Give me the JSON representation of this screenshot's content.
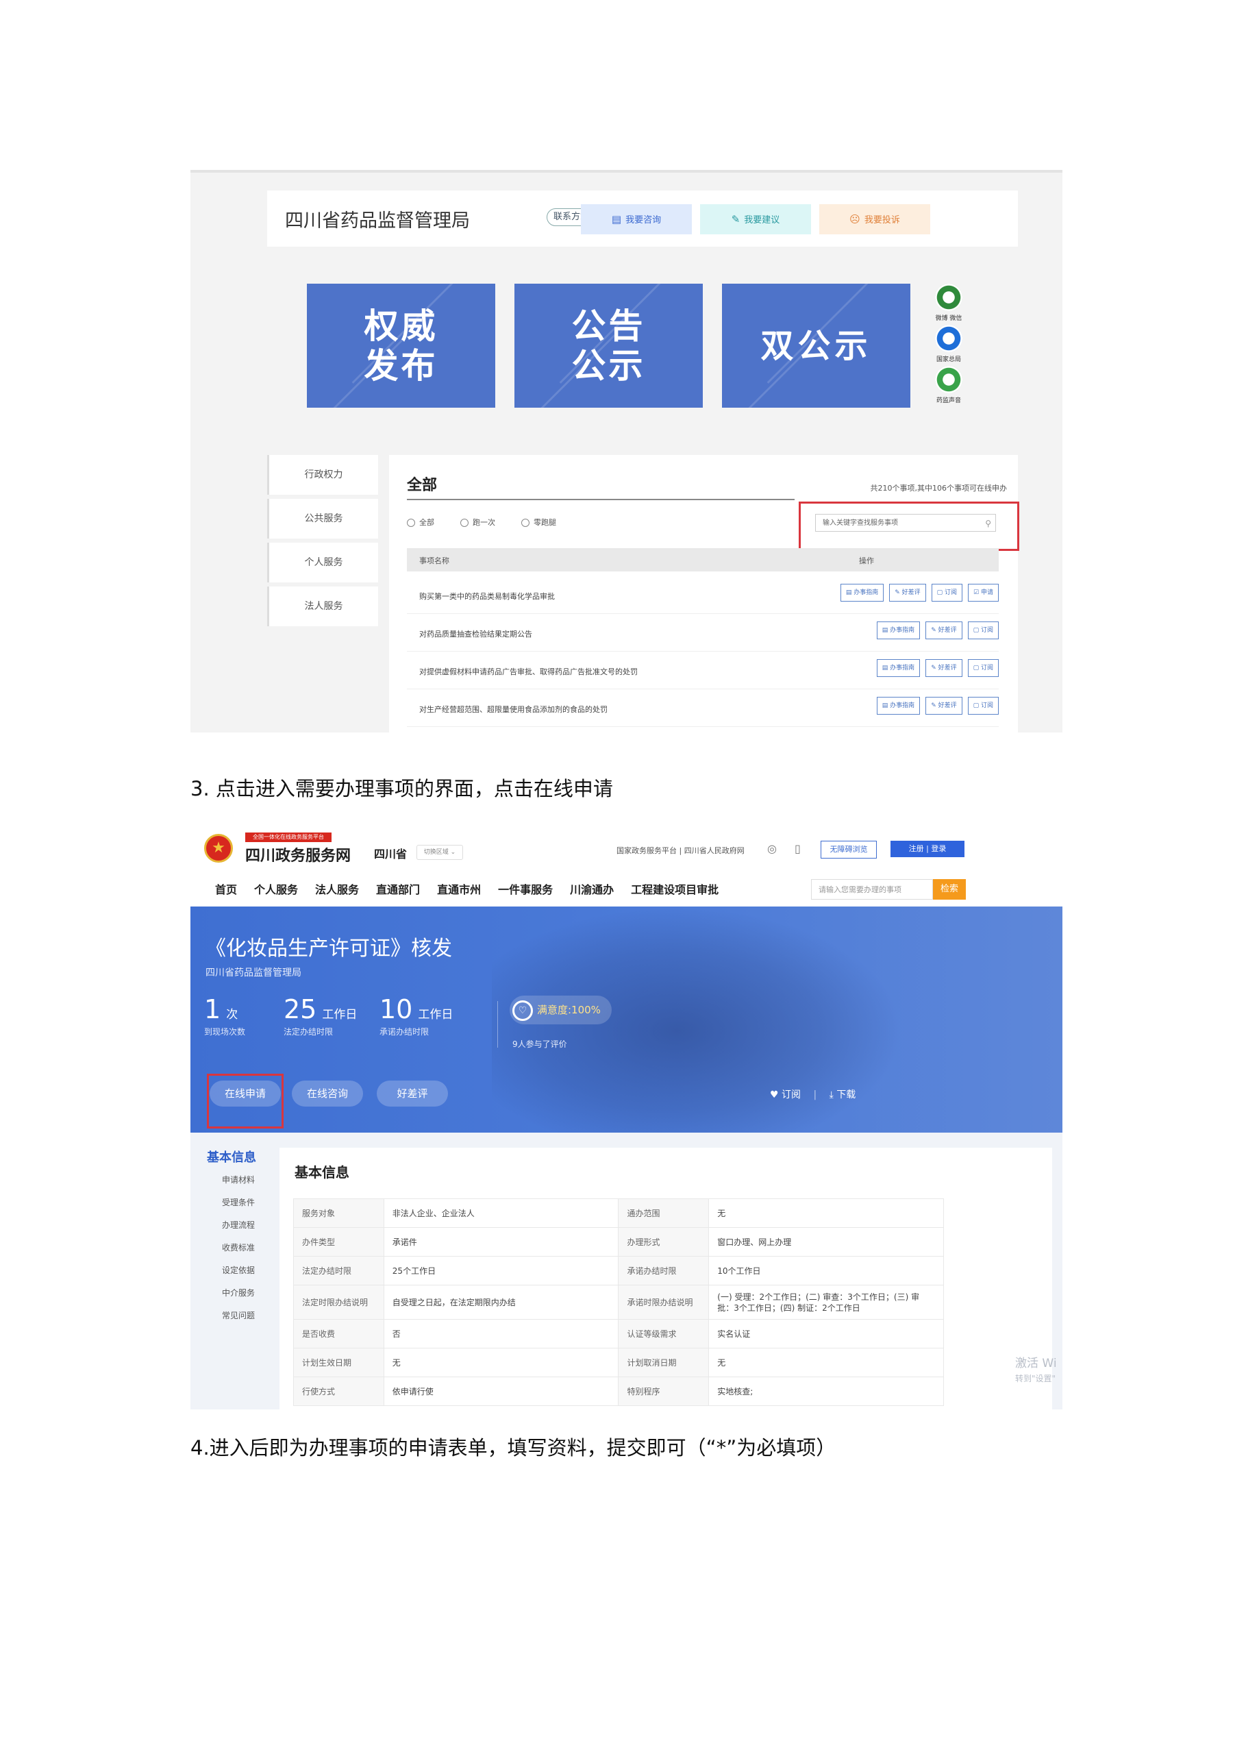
{
  "shot1": {
    "agency_title": "四川省药品监督管理局",
    "contact": "联系方式",
    "actions": [
      {
        "icon": "document-icon",
        "glyph": "▤",
        "label": "我要咨询",
        "bg": "#dfeafc",
        "color": "#3c6ad0"
      },
      {
        "icon": "pencil-icon",
        "glyph": "✎",
        "label": "我要建议",
        "bg": "#dcf6f6",
        "color": "#2a9aa0"
      },
      {
        "icon": "thumb-down-icon",
        "glyph": "☹",
        "label": "我要投诉",
        "bg": "#fdeede",
        "color": "#e0813a"
      }
    ],
    "banners": [
      "权威\n发布",
      "公告\n公示",
      "双公示"
    ],
    "qr_codes": [
      {
        "label": "微博 微信",
        "color": "#2f8a3b"
      },
      {
        "label": "国家总局",
        "color": "#1e6ed8"
      },
      {
        "label": "药监声音",
        "color": "#39a34a"
      }
    ],
    "side_items": [
      "行政权力",
      "公共服务",
      "个人服务",
      "法人服务"
    ],
    "section_title": "全部",
    "count_text": "共210个事项,其中106个事项可在线申办",
    "radios": [
      "全部",
      "跑一次",
      "零跑腿"
    ],
    "search_placeholder": "输入关键字查找服务事项",
    "table_headers": [
      "事项名称",
      "操作"
    ],
    "rows": [
      {
        "name": "购买第一类中的药品类易制毒化学品审批",
        "buttons": [
          "办事指南",
          "好差评",
          "订阅",
          "申请"
        ]
      },
      {
        "name": "对药品质量抽查检验结果定期公告",
        "buttons": [
          "办事指南",
          "好差评",
          "订阅"
        ]
      },
      {
        "name": "对提供虚假材料申请药品广告审批、取得药品广告批准文号的处罚",
        "buttons": [
          "办事指南",
          "好差评",
          "订阅"
        ]
      },
      {
        "name": "对生产经营超范围、超限量使用食品添加剂的食品的处罚",
        "buttons": [
          "办事指南",
          "好差评",
          "订阅"
        ]
      }
    ]
  },
  "step3_caption": "3. 点击进入需要办理事项的界面，点击在线申请",
  "shot2": {
    "platform_strip": "全国一体化在线政务服务平台",
    "site_name": "四川政务服务网",
    "province": "四川省",
    "switch_region": "切换区域 ⌄",
    "top_links": "国家政务服务平台 | 四川省人民政府网",
    "accessible": "无障碍浏览",
    "login": "注册 | 登录",
    "nav": [
      "首页",
      "个人服务",
      "法人服务",
      "直通部门",
      "直通市州",
      "一件事服务",
      "川渝通办",
      "工程建设项目审批"
    ],
    "search_placeholder": "请输入您需要办理的事项",
    "search_button": "检索",
    "item_title": "《化妆品生产许可证》核发",
    "department": "四川省药品监督管理局",
    "stats": [
      {
        "num": "1",
        "unit": "次",
        "label": "到现场次数"
      },
      {
        "num": "25",
        "unit": "工作日",
        "label": "法定办结时限"
      },
      {
        "num": "10",
        "unit": "工作日",
        "label": "承诺办结时限"
      }
    ],
    "satisfaction": "满意度:100%",
    "rated": "9人参与了评价",
    "buttons": [
      "在线申请",
      "在线咨询",
      "好差评"
    ],
    "subscribe": "订阅",
    "download": "下载",
    "left_header": "基本信息",
    "left_items": [
      "申请材料",
      "受理条件",
      "办理流程",
      "收费标准",
      "设定依据",
      "中介服务",
      "常见问题"
    ],
    "card_title": "基本信息",
    "info_rows": [
      [
        "服务对象",
        "非法人企业、企业法人",
        "通办范围",
        "无"
      ],
      [
        "办件类型",
        "承诺件",
        "办理形式",
        "窗口办理、网上办理"
      ],
      [
        "法定办结时限",
        "25个工作日",
        "承诺办结时限",
        "10个工作日"
      ],
      [
        "法定时限办结说明",
        "自受理之日起，在法定期限内办结",
        "承诺时限办结说明",
        "(一) 受理：2个工作日；(二) 审查：3个工作日；(三) 审批：3个工作日；(四) 制证：2个工作日"
      ],
      [
        "是否收费",
        "否",
        "认证等级需求",
        "实名认证"
      ],
      [
        "计划生效日期",
        "无",
        "计划取消日期",
        "无"
      ],
      [
        "行使方式",
        "依申请行使",
        "特别程序",
        "实地核查;"
      ]
    ],
    "watermark_line1": "激活 Wi",
    "watermark_line2": "转到\"设置\""
  },
  "step4_caption": "4.进入后即为办理事项的申请表单，填写资料，提交即可（“*”为必填项）"
}
